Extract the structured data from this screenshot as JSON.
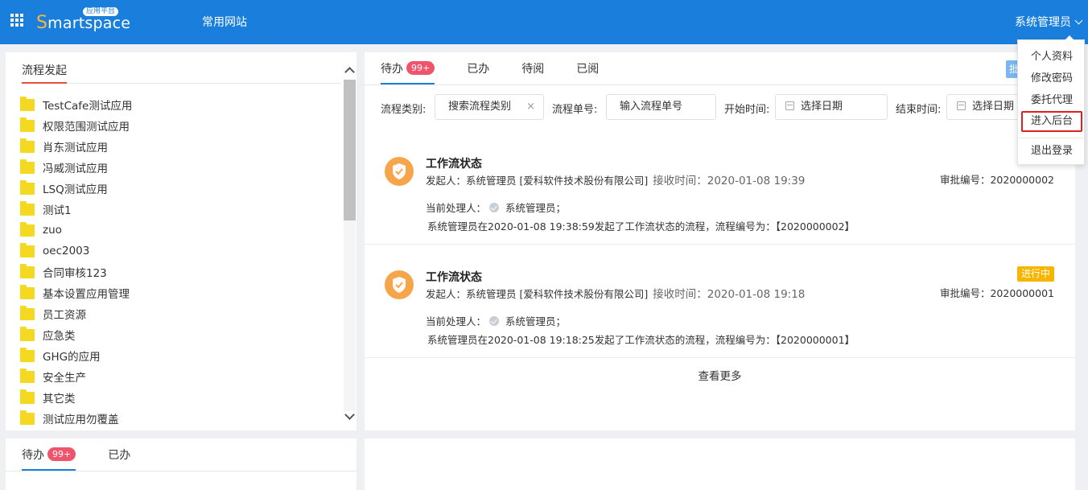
{
  "header": {
    "logo_text_s": "S",
    "logo_text_rest": "martspace",
    "logo_badge": "应用平台",
    "nav_link": "常用网站",
    "user_name": "系统管理员"
  },
  "user_dropdown": {
    "items": [
      "个人资料",
      "修改密码",
      "委托代理",
      "进入后台",
      "退出登录"
    ],
    "highlighted": "进入后台"
  },
  "process_launch": {
    "title": "流程发起",
    "folders": [
      "TestCafe测试应用",
      "权限范围测试应用",
      "肖东测试应用",
      "冯威测试应用",
      "LSQ测试应用",
      "测试1",
      "zuo",
      "oec2003",
      "合同审核123",
      "基本设置应用管理",
      "员工资源",
      "应急类",
      "GHG的应用",
      "安全生产",
      "其它类",
      "测试应用勿覆盖"
    ]
  },
  "main": {
    "tabs": [
      {
        "label": "待办",
        "badge": "99+"
      },
      {
        "label": "已办"
      },
      {
        "label": "待阅"
      },
      {
        "label": "已阅"
      }
    ],
    "corner_tag": "批",
    "filters": {
      "category_label": "流程类别:",
      "category_placeholder": "搜索流程类别",
      "clear": "×",
      "number_label": "流程单号:",
      "number_placeholder": "输入流程单号",
      "start_label": "开始时间:",
      "start_placeholder": "选择日期",
      "end_label": "结束时间:",
      "end_placeholder": "选择日期"
    },
    "cards": [
      {
        "title": "工作流状态",
        "initiator": "发起人：系统管理员 [爱科软件技术股份有限公司]",
        "received": "接收时间：2020-01-08 19:39",
        "approval_no": "审批编号：2020000002",
        "handler_label": "当前处理人：",
        "handler": "系统管理员；",
        "description": "系统管理员在2020-01-08 19:38:59发起了工作流状态的流程，流程编号为：【2020000002】",
        "status": ""
      },
      {
        "title": "工作流状态",
        "initiator": "发起人：系统管理员 [爱科软件技术股份有限公司]",
        "received": "接收时间：2020-01-08 19:18",
        "approval_no": "审批编号：2020000001",
        "handler_label": "当前处理人：",
        "handler": "系统管理员；",
        "description": "系统管理员在2020-01-08 19:18:25发起了工作流状态的流程，流程编号为：【2020000001】",
        "status": "进行中"
      }
    ],
    "view_more": "查看更多"
  },
  "bottom_left": {
    "tabs": [
      {
        "label": "待办",
        "badge": "99+"
      },
      {
        "label": "已办"
      }
    ]
  },
  "colors": {
    "header_bg": "#1a7fdc",
    "badge": "#f0546b",
    "status_tag": "#f7b500",
    "shield": "#f7a54a",
    "folder": "#f5d820",
    "highlight_border": "#e02020"
  }
}
